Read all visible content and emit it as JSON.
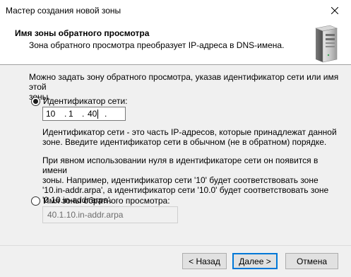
{
  "window": {
    "title": "Мастер создания новой зоны",
    "close_icon": "close-icon"
  },
  "header": {
    "title": "Имя зоны обратного просмотра",
    "subtitle": "Зона обратного просмотра преобразует IP-адреса в DNS-имена.",
    "icon": "server-icon"
  },
  "intro": {
    "line1": "Можно задать зону обратного просмотра, указав идентификатор сети или имя этой",
    "line2": "зоны."
  },
  "network_id": {
    "label": "Идентификатор сети:",
    "selected": true,
    "octets": [
      "10",
      "1",
      "40",
      ""
    ],
    "separator": "."
  },
  "help": {
    "p1_line1": "Идентификатор сети - это часть IP-адресов, которые принадлежат данной",
    "p1_line2": "зоне. Введите идентификатор сети в обычном (не в обратном) порядке.",
    "p2_line1": "При явном использовании нуля в идентификаторе сети он появится в имени",
    "p2_line2": "зоны. Например, идентификатор сети '10' будет соответствовать зоне",
    "p2_line3": "'10.in-addr.arpa', а идентификатор сети '10.0' будет соответствовать зоне",
    "p2_line4": "'0.10.in-addr.arpa'."
  },
  "zone_name": {
    "label": "Имя зоны обратного просмотра:",
    "selected": false,
    "value": "40.1.10.in-addr.arpa"
  },
  "buttons": {
    "back": "< Назад",
    "next": "Далее >",
    "cancel": "Отмена"
  }
}
